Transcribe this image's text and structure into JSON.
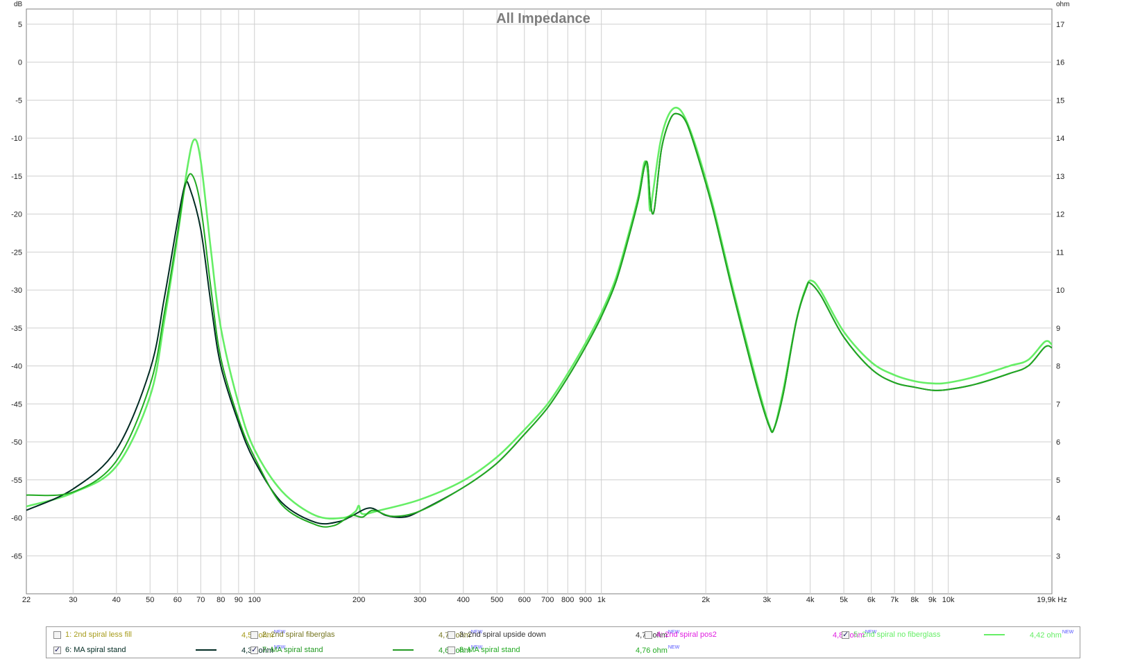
{
  "chart_data": {
    "type": "line",
    "title": "All Impedance",
    "y_left_unit": "dB",
    "y_right_unit": "ohm",
    "x_unit": "Hz",
    "x_scale": "log",
    "xlim": [
      22,
      19900
    ],
    "ylim_left": [
      -70,
      7
    ],
    "ylim_right": [
      2,
      17.4
    ],
    "grid": true,
    "x_ticks": [
      {
        "v": 22,
        "l": "22"
      },
      {
        "v": 30,
        "l": "30"
      },
      {
        "v": 40,
        "l": "40"
      },
      {
        "v": 50,
        "l": "50"
      },
      {
        "v": 60,
        "l": "60"
      },
      {
        "v": 70,
        "l": "70"
      },
      {
        "v": 80,
        "l": "80"
      },
      {
        "v": 90,
        "l": "90"
      },
      {
        "v": 100,
        "l": "100"
      },
      {
        "v": 200,
        "l": "200"
      },
      {
        "v": 300,
        "l": "300"
      },
      {
        "v": 400,
        "l": "400"
      },
      {
        "v": 500,
        "l": "500"
      },
      {
        "v": 600,
        "l": "600"
      },
      {
        "v": 700,
        "l": "700"
      },
      {
        "v": 800,
        "l": "800"
      },
      {
        "v": 900,
        "l": "900"
      },
      {
        "v": 1000,
        "l": "1k"
      },
      {
        "v": 2000,
        "l": "2k"
      },
      {
        "v": 3000,
        "l": "3k"
      },
      {
        "v": 4000,
        "l": "4k"
      },
      {
        "v": 5000,
        "l": "5k"
      },
      {
        "v": 6000,
        "l": "6k"
      },
      {
        "v": 7000,
        "l": "7k"
      },
      {
        "v": 8000,
        "l": "8k"
      },
      {
        "v": 9000,
        "l": "9k"
      },
      {
        "v": 10000,
        "l": "10k"
      },
      {
        "v": 19900,
        "l": "19,9k Hz"
      }
    ],
    "y_left_ticks": [
      5,
      0,
      -5,
      -10,
      -15,
      -20,
      -25,
      -30,
      -35,
      -40,
      -45,
      -50,
      -55,
      -60,
      -65
    ],
    "y_right_ticks": [
      17,
      16,
      15,
      14,
      13,
      12,
      11,
      10,
      9,
      8,
      7,
      6,
      5,
      4,
      3
    ],
    "series": [
      {
        "name": "5: 2nd spiral no fiberglass",
        "color": "#66ee66",
        "points": [
          [
            22,
            -58.5
          ],
          [
            30,
            -56.7
          ],
          [
            40,
            -53.2
          ],
          [
            50,
            -44
          ],
          [
            55,
            -34
          ],
          [
            60,
            -23
          ],
          [
            64,
            -14
          ],
          [
            67,
            -10.2
          ],
          [
            70,
            -13
          ],
          [
            75,
            -25
          ],
          [
            80,
            -35
          ],
          [
            90,
            -45
          ],
          [
            100,
            -51
          ],
          [
            120,
            -56.5
          ],
          [
            150,
            -59.7
          ],
          [
            180,
            -60
          ],
          [
            195,
            -59.2
          ],
          [
            200,
            -58.4
          ],
          [
            205,
            -59.5
          ],
          [
            230,
            -59
          ],
          [
            300,
            -57.6
          ],
          [
            400,
            -55.1
          ],
          [
            500,
            -52
          ],
          [
            600,
            -48.4
          ],
          [
            700,
            -45
          ],
          [
            800,
            -41
          ],
          [
            900,
            -37
          ],
          [
            1000,
            -33
          ],
          [
            1100,
            -28.5
          ],
          [
            1200,
            -22.5
          ],
          [
            1280,
            -17.5
          ],
          [
            1330,
            -13.2
          ],
          [
            1360,
            -14.5
          ],
          [
            1380,
            -19.5
          ],
          [
            1410,
            -17
          ],
          [
            1480,
            -10.5
          ],
          [
            1560,
            -7
          ],
          [
            1650,
            -6
          ],
          [
            1750,
            -7.5
          ],
          [
            1900,
            -12
          ],
          [
            2100,
            -19
          ],
          [
            2400,
            -30
          ],
          [
            2800,
            -42
          ],
          [
            3050,
            -47.8
          ],
          [
            3150,
            -48.2
          ],
          [
            3350,
            -43
          ],
          [
            3650,
            -34
          ],
          [
            3900,
            -29.5
          ],
          [
            4050,
            -28.8
          ],
          [
            4300,
            -30.2
          ],
          [
            5000,
            -35.5
          ],
          [
            6000,
            -39.5
          ],
          [
            7000,
            -41.2
          ],
          [
            8000,
            -42
          ],
          [
            9000,
            -42.3
          ],
          [
            10000,
            -42.2
          ],
          [
            12000,
            -41.4
          ],
          [
            15000,
            -40
          ],
          [
            17000,
            -39.2
          ],
          [
            19000,
            -36.8
          ],
          [
            19900,
            -37.2
          ]
        ]
      },
      {
        "name": "6: MA spiral stand",
        "color": "#002a22",
        "points": [
          [
            22,
            -59
          ],
          [
            30,
            -56.2
          ],
          [
            40,
            -51
          ],
          [
            50,
            -40.5
          ],
          [
            55,
            -31
          ],
          [
            60,
            -21
          ],
          [
            63,
            -16.2
          ],
          [
            65,
            -16.5
          ],
          [
            70,
            -22
          ],
          [
            75,
            -32
          ],
          [
            80,
            -40
          ],
          [
            90,
            -47.5
          ],
          [
            100,
            -52.5
          ],
          [
            120,
            -58
          ],
          [
            150,
            -60.6
          ],
          [
            175,
            -60.5
          ],
          [
            190,
            -59.8
          ],
          [
            215,
            -58.7
          ],
          [
            240,
            -59.7
          ],
          [
            270,
            -59.9
          ],
          [
            300,
            -59.1
          ],
          [
            400,
            -56
          ],
          [
            500,
            -52.8
          ],
          [
            600,
            -49
          ],
          [
            700,
            -45.5
          ],
          [
            800,
            -41.5
          ],
          [
            900,
            -37.5
          ],
          [
            1000,
            -33.5
          ],
          [
            1100,
            -29
          ],
          [
            1200,
            -23
          ],
          [
            1280,
            -18
          ],
          [
            1330,
            -13.8
          ],
          [
            1360,
            -13.5
          ],
          [
            1385,
            -18.5
          ],
          [
            1420,
            -19.5
          ],
          [
            1490,
            -11.5
          ],
          [
            1580,
            -7.5
          ],
          [
            1660,
            -6.8
          ],
          [
            1760,
            -8
          ],
          [
            1900,
            -12.5
          ],
          [
            2100,
            -19.5
          ],
          [
            2400,
            -30.5
          ],
          [
            2800,
            -42.5
          ],
          [
            3050,
            -48
          ],
          [
            3150,
            -48.2
          ],
          [
            3350,
            -43.5
          ],
          [
            3650,
            -34
          ],
          [
            3900,
            -29.7
          ],
          [
            4000,
            -29.1
          ],
          [
            4300,
            -30.8
          ],
          [
            5000,
            -36.2
          ],
          [
            6000,
            -40.4
          ],
          [
            7000,
            -42.2
          ],
          [
            8000,
            -42.8
          ],
          [
            9000,
            -43.2
          ],
          [
            10000,
            -43.1
          ],
          [
            12000,
            -42.4
          ],
          [
            15000,
            -41
          ],
          [
            17000,
            -40
          ],
          [
            19000,
            -37.5
          ],
          [
            19900,
            -37.6
          ]
        ]
      },
      {
        "name": "7: MA spiral stand",
        "color": "#22aa22",
        "points": [
          [
            22,
            -57
          ],
          [
            30,
            -56.6
          ],
          [
            40,
            -52.5
          ],
          [
            50,
            -42.5
          ],
          [
            55,
            -33
          ],
          [
            60,
            -22.5
          ],
          [
            63,
            -16.5
          ],
          [
            66,
            -14.8
          ],
          [
            70,
            -19
          ],
          [
            75,
            -30
          ],
          [
            80,
            -39
          ],
          [
            90,
            -47
          ],
          [
            100,
            -52
          ],
          [
            120,
            -58.3
          ],
          [
            150,
            -60.9
          ],
          [
            170,
            -61
          ],
          [
            190,
            -59.7
          ],
          [
            205,
            -59.9
          ],
          [
            220,
            -59
          ],
          [
            250,
            -59.8
          ],
          [
            300,
            -59.1
          ],
          [
            400,
            -56
          ],
          [
            500,
            -52.8
          ],
          [
            600,
            -49
          ],
          [
            700,
            -45.5
          ],
          [
            800,
            -41.5
          ],
          [
            900,
            -37.5
          ],
          [
            1000,
            -33.5
          ],
          [
            1100,
            -29
          ],
          [
            1200,
            -23
          ],
          [
            1280,
            -18
          ],
          [
            1330,
            -13.8
          ],
          [
            1360,
            -13.5
          ],
          [
            1385,
            -18.5
          ],
          [
            1420,
            -19.5
          ],
          [
            1490,
            -11.5
          ],
          [
            1580,
            -7.5
          ],
          [
            1660,
            -6.8
          ],
          [
            1760,
            -8
          ],
          [
            1900,
            -12.5
          ],
          [
            2100,
            -19.5
          ],
          [
            2400,
            -30.5
          ],
          [
            2800,
            -42.5
          ],
          [
            3050,
            -48
          ],
          [
            3150,
            -48.2
          ],
          [
            3350,
            -43.5
          ],
          [
            3650,
            -34
          ],
          [
            3900,
            -29.7
          ],
          [
            4000,
            -29.1
          ],
          [
            4300,
            -30.8
          ],
          [
            5000,
            -36.2
          ],
          [
            6000,
            -40.4
          ],
          [
            7000,
            -42.2
          ],
          [
            8000,
            -42.8
          ],
          [
            9000,
            -43.2
          ],
          [
            10000,
            -43.1
          ],
          [
            12000,
            -42.4
          ],
          [
            15000,
            -41
          ],
          [
            17000,
            -40
          ],
          [
            19000,
            -37.5
          ],
          [
            19900,
            -37.6
          ]
        ]
      }
    ]
  },
  "legend": [
    {
      "name": "1: 2nd spiral less fill",
      "value": "4,52 ohm",
      "sup": "NEW",
      "checked": false,
      "color": "#a69b1a",
      "line": false
    },
    {
      "name": "2: 2nd spiral fiberglas",
      "value": "4,73 ohm",
      "sup": "NEW",
      "checked": false,
      "color": "#777722",
      "line": false
    },
    {
      "name": "3: 2nd spiral upside down",
      "value": "4,76 ohm",
      "sup": "NEW",
      "checked": false,
      "color": "#333333",
      "line": false
    },
    {
      "name": "4: 2nd spiral pos2",
      "value": "4,86 ohm",
      "sup": "NEW",
      "checked": false,
      "color": "#e020e0",
      "line": false
    },
    {
      "name": "5: 2nd spiral no fiberglass",
      "value": "4,42 ohm",
      "sup": "NEW",
      "checked": true,
      "color": "#66ee66",
      "line": true
    },
    {
      "name": "6: MA spiral stand",
      "value": "4,34 ohm",
      "sup": "NEW",
      "checked": true,
      "color": "#002a22",
      "line": true
    },
    {
      "name": "7: MA spiral stand",
      "value": "4,60 ohm",
      "sup": "NEW",
      "checked": true,
      "color": "#229922",
      "line": true
    },
    {
      "name": "8: MA spiral stand",
      "value": "4,76 ohm",
      "sup": "NEW",
      "checked": false,
      "color": "#22aa22",
      "line": false
    }
  ],
  "check_mark": "✓"
}
